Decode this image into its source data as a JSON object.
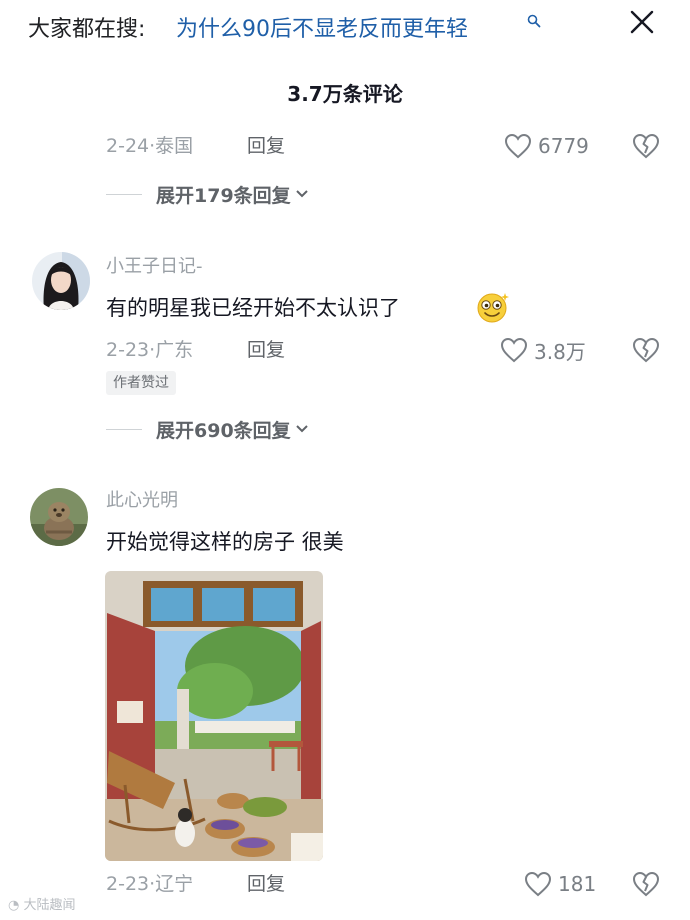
{
  "header": {
    "search_prefix": "大家都在搜:",
    "search_query": "为什么90后不显老反而更年轻"
  },
  "comments_count": "3.7万条评论",
  "comments": [
    {
      "date": "2-24",
      "location": "泰国",
      "reply_label": "回复",
      "like_count": "6779",
      "expand_label": "展开179条回复"
    },
    {
      "username": "小王子日记-",
      "text": "有的明星我已经开始不太认识了",
      "date": "2-23",
      "location": "广东",
      "reply_label": "回复",
      "like_count": "3.8万",
      "author_badge": "作者赞过",
      "expand_label": "展开690条回复"
    },
    {
      "username": "此心光明",
      "text": "开始觉得这样的房子 很美",
      "date": "2-23",
      "location": "辽宁",
      "reply_label": "回复",
      "like_count": "181"
    }
  ],
  "watermark": "大陆趣闻",
  "colors": {
    "query_link": "#1f5fa8",
    "meta_gray": "#9aa0a6",
    "text": "#161823"
  }
}
